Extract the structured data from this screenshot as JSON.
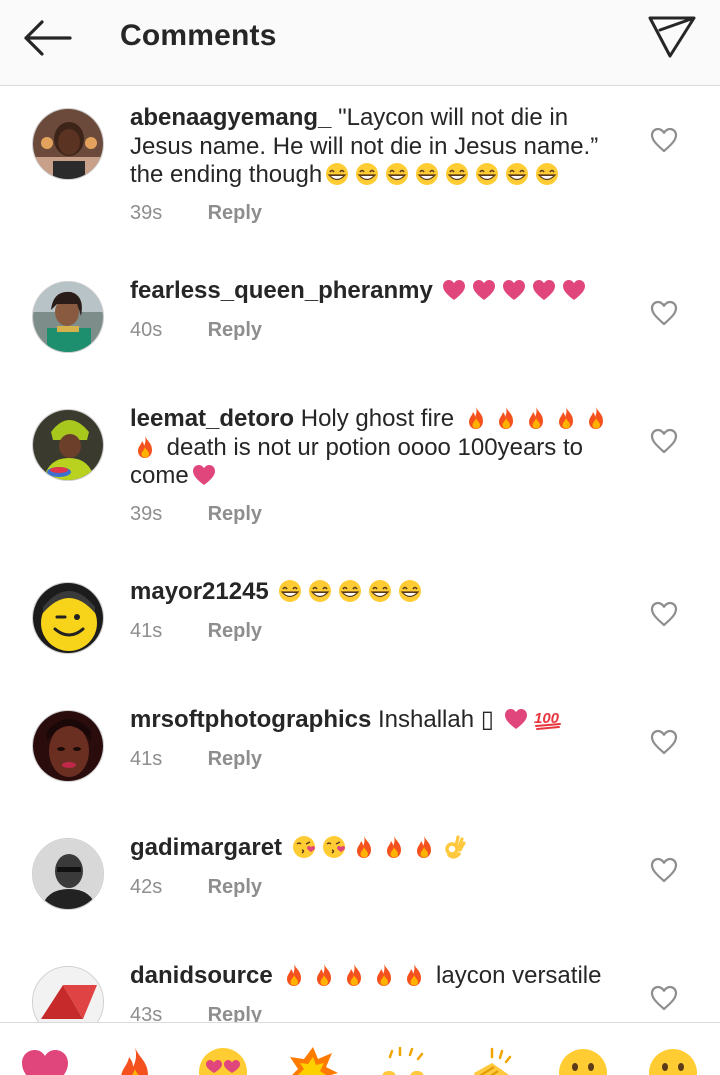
{
  "header": {
    "title": "Comments",
    "back_icon": "arrow-left-icon",
    "share_icon": "paper-plane-icon"
  },
  "colors": {
    "text": "#262626",
    "muted": "#8e8e8e",
    "heart_pink": "#e0457b",
    "fire": "#f4511e",
    "divider": "#dbdbdb"
  },
  "comments": [
    {
      "username": "abenaagyemang_",
      "text": "\"Laycon will not die in Jesus name. He will not die in Jesus name.” the ending though",
      "emojis_after": [
        "grin",
        "grin",
        "grin",
        "grin",
        "grin",
        "grin",
        "grin",
        "grin"
      ],
      "time": "39s",
      "reply": "Reply"
    },
    {
      "username": "fearless_queen_pheranmy",
      "text": "",
      "emojis_after": [
        "heart",
        "heart",
        "heart",
        "heart",
        "heart"
      ],
      "time": "40s",
      "reply": "Reply"
    },
    {
      "username": "leemat_detoro",
      "text_a": "Holy ghost fire",
      "emojis_mid": [
        "fire",
        "fire",
        "fire",
        "fire",
        "fire",
        "fire"
      ],
      "text_b": "death is not ur potion oooo 100years to come",
      "emojis_after": [
        "heart"
      ],
      "time": "39s",
      "reply": "Reply"
    },
    {
      "username": "mayor21245",
      "text": "",
      "emojis_after": [
        "grin",
        "grin",
        "grin",
        "grin",
        "grin"
      ],
      "time": "41s",
      "reply": "Reply"
    },
    {
      "username": "mrsoftphotographics",
      "text": "Inshallah ▯",
      "emojis_after": [
        "heart",
        "hundred"
      ],
      "time": "41s",
      "reply": "Reply"
    },
    {
      "username": "gadimargaret",
      "text": "",
      "emojis_after": [
        "kiss",
        "kiss",
        "fire",
        "fire",
        "fire",
        "ok"
      ],
      "time": "42s",
      "reply": "Reply"
    },
    {
      "username": "danidsource",
      "text_pre_emojis": [
        "fire",
        "fire",
        "fire",
        "fire",
        "fire"
      ],
      "text": "laycon versatile",
      "time": "43s",
      "reply": "Reply"
    }
  ],
  "quick_reactions": [
    "heart",
    "fire",
    "heart-eyes",
    "boom",
    "raised-hands",
    "clap",
    "smile",
    "smile"
  ]
}
